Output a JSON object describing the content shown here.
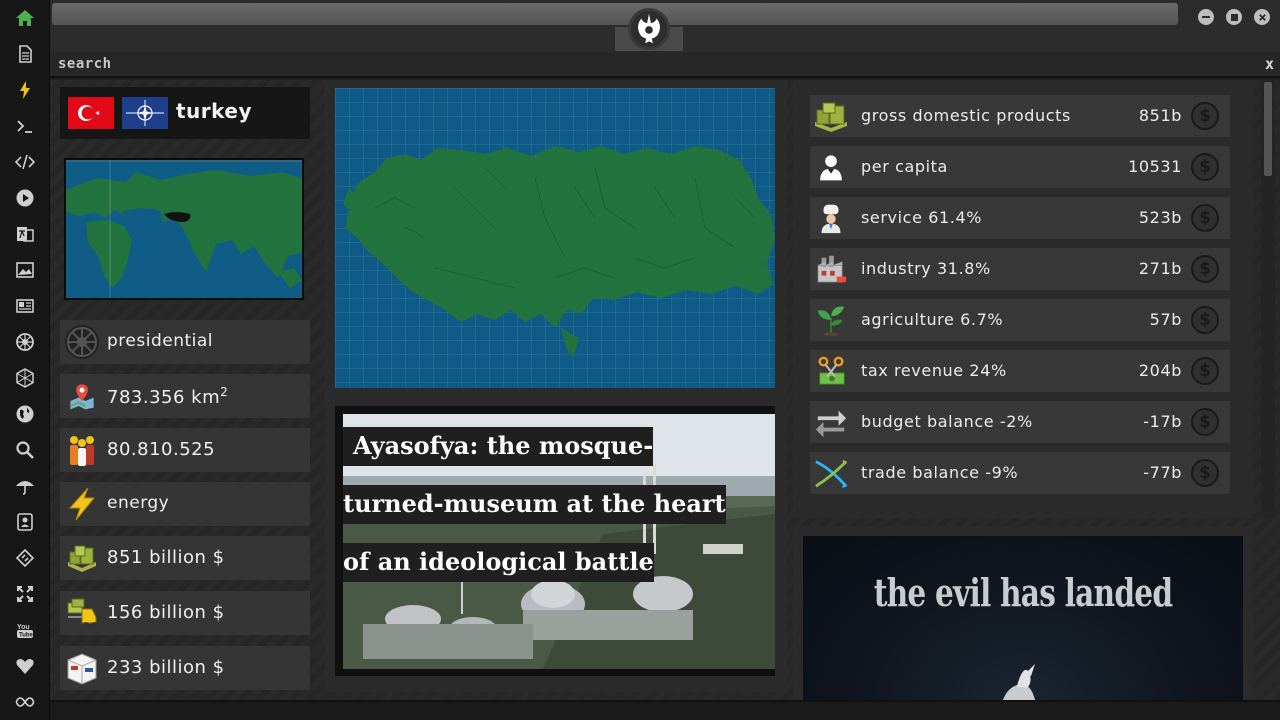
{
  "window": {
    "title_field": "",
    "emblem": "rebel-alliance-icon"
  },
  "search": {
    "label": "search",
    "close": "x"
  },
  "country": {
    "name": "turkey",
    "flags": [
      "turkey-flag",
      "nato-flag"
    ],
    "stats": [
      {
        "icon": "galactic-empire-icon",
        "text": "presidential"
      },
      {
        "icon": "map-pin-icon",
        "text": "783.356 km",
        "sup": "2"
      },
      {
        "icon": "people-icon",
        "text": "80.810.525"
      },
      {
        "icon": "lightning-icon",
        "text": "energy"
      },
      {
        "icon": "money-stack-icon",
        "text": "851 billion $"
      },
      {
        "icon": "money-forklift-icon",
        "text": "156 billion $"
      },
      {
        "icon": "cargo-box-icon",
        "text": "233 billion $"
      }
    ]
  },
  "news": {
    "headline_lines": [
      "Ayasofya: the mosque-",
      "turned-museum at the heart",
      "of an ideological battle"
    ]
  },
  "economy": {
    "rows": [
      {
        "icon": "money-stack-icon",
        "label": "gross domestic products",
        "value": "851b"
      },
      {
        "icon": "person-icon",
        "label": "per capita",
        "value": "10531"
      },
      {
        "icon": "chef-icon",
        "label": "service 61.4%",
        "value": "523b"
      },
      {
        "icon": "factory-icon",
        "label": "industry 31.8%",
        "value": "271b"
      },
      {
        "icon": "sprout-icon",
        "label": "agriculture 6.7%",
        "value": "57b"
      },
      {
        "icon": "scissors-money-icon",
        "label": "tax revenue 24%",
        "value": "204b"
      },
      {
        "icon": "exchange-arrows-icon",
        "label": "budget balance -2%",
        "value": "-17b"
      },
      {
        "icon": "trade-cross-icon",
        "label": "trade balance -9%",
        "value": "-77b"
      }
    ],
    "currency_symbol": "$"
  },
  "promo": {
    "title": "the evil has landed"
  },
  "colors": {
    "map_land": "#23733f",
    "map_water": "#0d5b86",
    "nav_active": "#4caf50",
    "nav_accent": "#f0c419"
  }
}
